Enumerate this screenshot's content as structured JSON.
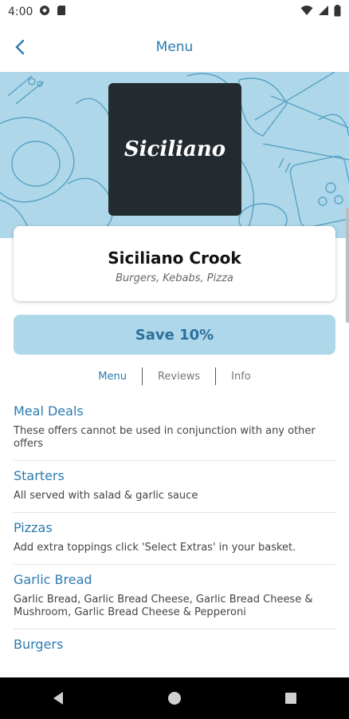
{
  "status": {
    "time": "4:00"
  },
  "appbar": {
    "title": "Menu"
  },
  "logo": {
    "text": "Siciliano"
  },
  "restaurant": {
    "name": "Siciliano Crook",
    "cuisine": "Burgers, Kebabs, Pizza"
  },
  "save": {
    "label": "Save 10%"
  },
  "tabs": [
    {
      "label": "Menu",
      "active": true
    },
    {
      "label": "Reviews",
      "active": false
    },
    {
      "label": "Info",
      "active": false
    }
  ],
  "sections": [
    {
      "title": "Meal Deals",
      "description": "These offers cannot be used in conjunction with any other offers"
    },
    {
      "title": "Starters",
      "description": "All served with salad & garlic sauce"
    },
    {
      "title": "Pizzas",
      "description": "Add extra toppings click 'Select Extras' in your basket."
    },
    {
      "title": "Garlic Bread",
      "description": "Garlic Bread, Garlic Bread Cheese, Garlic Bread Cheese & Mushroom, Garlic Bread Cheese & Pepperoni"
    },
    {
      "title": "Burgers",
      "description": ""
    }
  ],
  "colors": {
    "accent": "#2b7bb0",
    "hero_bg": "#aed8ea",
    "logo_bg": "#232a30"
  }
}
